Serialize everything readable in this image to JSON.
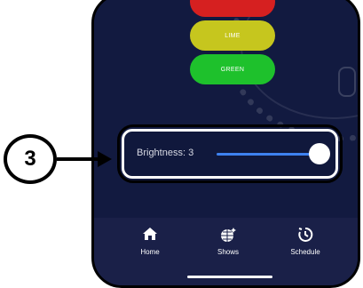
{
  "colors": [
    {
      "label": "",
      "bg": "#d62020"
    },
    {
      "label": "LIME",
      "bg": "#c6c61e"
    },
    {
      "label": "GREEN",
      "bg": "#1ec12c"
    }
  ],
  "brightness": {
    "label": "Brightness: 3",
    "value": 3,
    "fill_fraction": 1.0
  },
  "callout": {
    "number": "3"
  },
  "tabs": [
    {
      "label": "Home",
      "icon": "home-icon"
    },
    {
      "label": "Shows",
      "icon": "shows-icon"
    },
    {
      "label": "Schedule",
      "icon": "schedule-icon"
    }
  ],
  "theme": {
    "background": "#10183c",
    "accent": "#3e82f0"
  }
}
